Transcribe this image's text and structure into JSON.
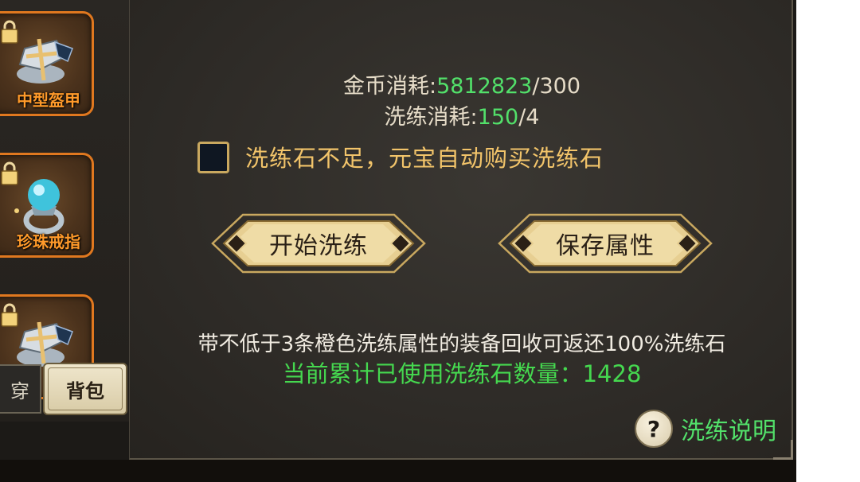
{
  "equipment": [
    {
      "name": "中型盔甲",
      "icon": "armor-icon"
    },
    {
      "name": "珍珠戒指",
      "icon": "pearl-ring-icon"
    },
    {
      "name": "",
      "icon": "armor-icon"
    }
  ],
  "tabs": {
    "wear": "穿",
    "bag": "背包"
  },
  "cost": {
    "gold_label": "金币消耗:",
    "gold_value": "5812823",
    "gold_required": "/300",
    "refine_label": "洗练消耗:",
    "refine_value": "150",
    "refine_required": "/4"
  },
  "auto_buy": {
    "label": "洗练石不足，元宝自动购买洗练石",
    "checked": false
  },
  "buttons": {
    "start": "开始洗练",
    "save": "保存属性"
  },
  "info": {
    "recycle_note": "带不低于3条橙色洗练属性的装备回收可返还100%洗练石",
    "used_count": "当前累计已使用洗练石数量：1428"
  },
  "help": {
    "label": "洗练说明",
    "icon_glyph": "?"
  },
  "colors": {
    "accent_green": "#52e06a",
    "gold_text": "#f2c46a",
    "slot_border": "#e0781f"
  }
}
